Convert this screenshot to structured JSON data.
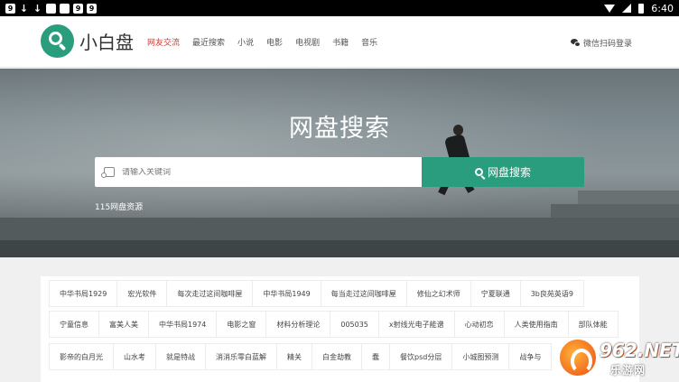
{
  "status_bar": {
    "icons": [
      "9",
      "↓",
      "↓",
      "",
      "",
      "9",
      "9"
    ],
    "time": "6:40"
  },
  "header": {
    "logo_text": "小白盘",
    "nav": [
      {
        "label": "网友交流",
        "active": true
      },
      {
        "label": "最近搜索",
        "active": false
      },
      {
        "label": "小说",
        "active": false
      },
      {
        "label": "电影",
        "active": false
      },
      {
        "label": "电视剧",
        "active": false
      },
      {
        "label": "书籍",
        "active": false
      },
      {
        "label": "音乐",
        "active": false
      }
    ],
    "login_label": "微信扫码登录"
  },
  "hero": {
    "title": "网盘搜索",
    "search_placeholder": "请输入关键词",
    "search_button": "网盘搜索",
    "link": "115网盘资源"
  },
  "tags": {
    "row1": [
      "中华书局1929",
      "宏光软件",
      "每次走过这间咖啡屋",
      "中华书局1949",
      "每当走过这间咖啡屋",
      "修仙之幻术师",
      "宁夏联通",
      "3b良苑英语9"
    ],
    "row2": [
      "宁童信息",
      "富美人美",
      "中华书局1974",
      "电影之窗",
      "材料分析理论",
      "005035",
      "x射线光电子能谱",
      "心动初恋",
      "人类使用指南",
      "部队体能"
    ],
    "row3": [
      "影帝的白月光",
      "山水考",
      "就是特战",
      "消消乐零白蓝解",
      "精关",
      "白金劫教",
      "蠢",
      "餐饮psd分层",
      "小城图预测",
      "战争与"
    ]
  },
  "watermark": {
    "brand": "962.NET",
    "sub": "乐游网"
  }
}
